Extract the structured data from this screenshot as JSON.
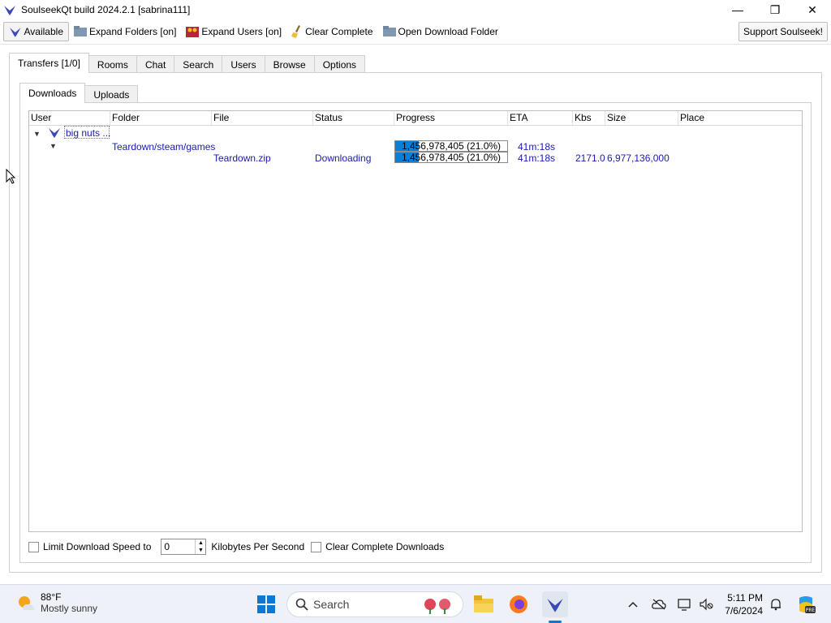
{
  "window": {
    "title": "SoulseekQt build 2024.2.1 [sabrina111]",
    "minimize": "—",
    "maximize": "❐",
    "close": "✕"
  },
  "toolbar": {
    "available": "Available",
    "expand_folders": "Expand Folders [on]",
    "expand_users": "Expand Users [on]",
    "clear_complete": "Clear Complete",
    "open_download_folder": "Open Download Folder",
    "support": "Support Soulseek!"
  },
  "main_tabs": [
    "Transfers [1/0]",
    "Rooms",
    "Chat",
    "Search",
    "Users",
    "Browse",
    "Options"
  ],
  "sub_tabs": [
    "Downloads",
    "Uploads"
  ],
  "table": {
    "columns": [
      "User",
      "Folder",
      "File",
      "Status",
      "Progress",
      "ETA",
      "Kbs",
      "Size",
      "Place"
    ],
    "user_row": {
      "user": "big nuts ..."
    },
    "folder_row": {
      "folder": "Teardown/steam/games",
      "progress_text": "1,456,978,405 (21.0%)",
      "progress": 0.21,
      "eta": "41m:18s"
    },
    "file_row": {
      "file": "Teardown.zip",
      "status": "Downloading",
      "progress_text": "1,456,978,405 (21.0%)",
      "progress": 0.21,
      "eta": "41m:18s",
      "kbs": "2171.0",
      "size": "6,977,136,000"
    }
  },
  "bottom": {
    "limit_label": "Limit Download Speed to",
    "speed_value": "0",
    "unit_label": "Kilobytes Per Second",
    "clear_label": "Clear Complete Downloads"
  },
  "taskbar": {
    "temperature": "88°F",
    "condition": "Mostly sunny",
    "search_label": "Search",
    "time": "5:11 PM",
    "date": "7/6/2024"
  },
  "colors": {
    "accent": "#0a7fd8",
    "link_text": "#1a1ab0"
  }
}
